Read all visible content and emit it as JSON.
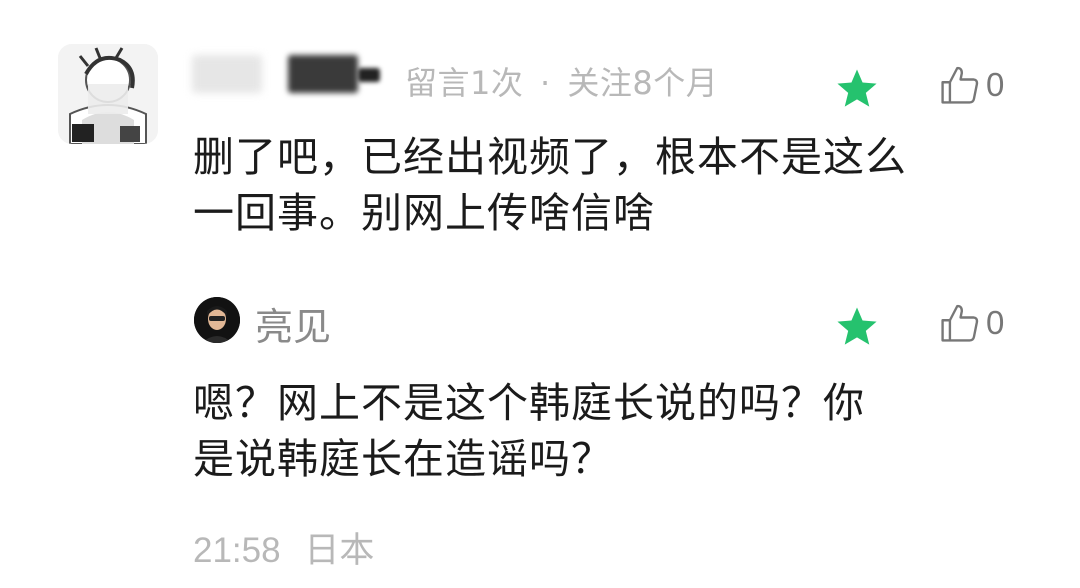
{
  "top_comment": {
    "meta": {
      "comment_count": "留言1次",
      "separator": "·",
      "follow_duration": "关注8个月"
    },
    "like_count": "0",
    "text_line1": "删了吧，已经出视频了，根本不是这么",
    "text_line2": "一回事。别网上传啥信啥"
  },
  "reply": {
    "author": "亮见",
    "like_count": "0",
    "text_line1": "嗯？网上不是这个韩庭长说的吗？你",
    "text_line2": "是说韩庭长在造谣吗？"
  },
  "footer": {
    "time": "21:58",
    "location": "日本"
  },
  "colors": {
    "star": "#25c26e",
    "muted_text": "#b8b8b8",
    "body_text": "#1b1b1b"
  },
  "icons": [
    "star-icon",
    "thumbs-up-icon"
  ]
}
